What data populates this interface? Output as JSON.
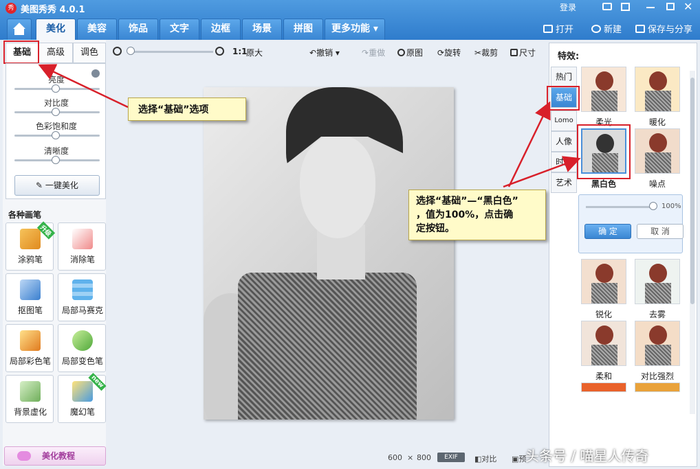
{
  "app": {
    "title": "美图秀秀 4.0.1",
    "logo_text": "秀"
  },
  "window": {
    "login_label": "登录"
  },
  "nav": {
    "tabs": [
      "美化",
      "美容",
      "饰品",
      "文字",
      "边框",
      "场景",
      "拼图",
      "更多功能"
    ],
    "actions": {
      "open": "打开",
      "new": "新建",
      "save_share": "保存与分享"
    }
  },
  "left": {
    "subtabs": [
      "基础",
      "高级",
      "调色"
    ],
    "sliders": [
      {
        "label": "亮度",
        "level": 0.5
      },
      {
        "label": "对比度",
        "level": 0.5
      },
      {
        "label": "色彩饱和度",
        "level": 0.5
      },
      {
        "label": "清晰度",
        "level": 0.5
      }
    ],
    "one_click_label": "一键美化",
    "brushes_title": "各种画笔",
    "brushes": [
      {
        "label": "涂鸦笔",
        "badge": "升级"
      },
      {
        "label": "消除笔",
        "badge": ""
      },
      {
        "label": "抠图笔",
        "badge": ""
      },
      {
        "label": "局部马赛克",
        "badge": ""
      },
      {
        "label": "局部彩色笔",
        "badge": ""
      },
      {
        "label": "局部变色笔",
        "badge": ""
      },
      {
        "label": "背景虚化",
        "badge": ""
      },
      {
        "label": "魔幻笔",
        "badge": "new"
      }
    ],
    "tutorial_label": "美化教程"
  },
  "toolbar": {
    "zoom_ratio": "1:1",
    "original_size": "原大",
    "undo": "撤销",
    "redo": "重做",
    "original": "原图",
    "rotate": "旋转",
    "crop": "裁剪",
    "size": "尺寸"
  },
  "status": {
    "width": "600",
    "times": "×",
    "height": "800",
    "exif": "EXIF",
    "compare": "对比",
    "preview": "预"
  },
  "effects": {
    "title": "特效:",
    "categories": [
      "热门",
      "基础",
      "Lomo",
      "人像",
      "时尚",
      "艺术"
    ],
    "active_category": "基础",
    "thumbs": [
      "柔光",
      "暖化",
      "黑白色",
      "噪点",
      "锐化",
      "去雾",
      "柔和",
      "对比强烈"
    ],
    "popup": {
      "value": "100%",
      "level": 1.0,
      "confirm": "确 定",
      "cancel": "取 消"
    }
  },
  "callouts": {
    "one": "选择“基础”选项",
    "two": "选择“基础”—“黑白色”\n，值为100%，点击确\n定按钮。"
  },
  "watermark": "头条号 / 喵星人传奇",
  "colors": {
    "accent": "#3a86d3",
    "highlight": "#d8202a",
    "callout_bg": "#fffbc9"
  }
}
